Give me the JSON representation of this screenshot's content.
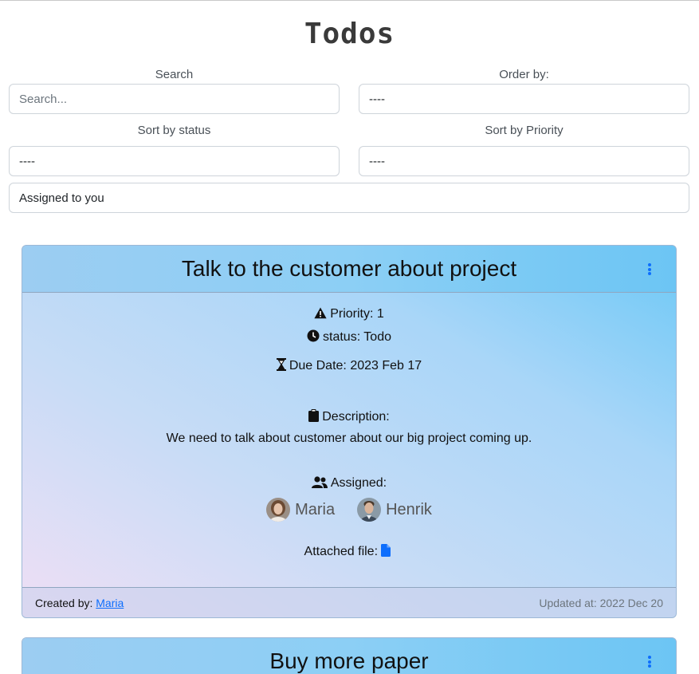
{
  "page": {
    "title": "Todos"
  },
  "filters": {
    "search": {
      "label": "Search",
      "placeholder": "Search..."
    },
    "order_by": {
      "label": "Order by:",
      "value": "----"
    },
    "sort_status": {
      "label": "Sort by status",
      "value": "----"
    },
    "sort_priority": {
      "label": "Sort by Priority",
      "value": "----"
    },
    "assigned": {
      "value": "Assigned to you"
    }
  },
  "todos": [
    {
      "title": "Talk to the customer about project",
      "priority": "Priority: 1",
      "status": "status: Todo",
      "due": "Due Date: 2023 Feb 17",
      "description_label": "Description:",
      "description": "We need to talk about customer about our big project coming up.",
      "assigned_label": "Assigned:",
      "assignees": [
        {
          "name": "Maria"
        },
        {
          "name": "Henrik"
        }
      ],
      "attached_label": "Attached file:",
      "created_label": "Created by:",
      "created_by": "Maria",
      "updated": "Updated at: 2022 Dec 20"
    },
    {
      "title": "Buy more paper"
    }
  ],
  "icons": {
    "priority": "warning-triangle-icon",
    "status": "clock-icon",
    "due": "hourglass-icon",
    "description": "clipboard-icon",
    "assigned": "users-icon",
    "file": "file-icon",
    "menu": "kebab-menu-icon"
  },
  "colors": {
    "accent": "#0d6efd",
    "card_gradient_end": "#6cc8f6"
  }
}
